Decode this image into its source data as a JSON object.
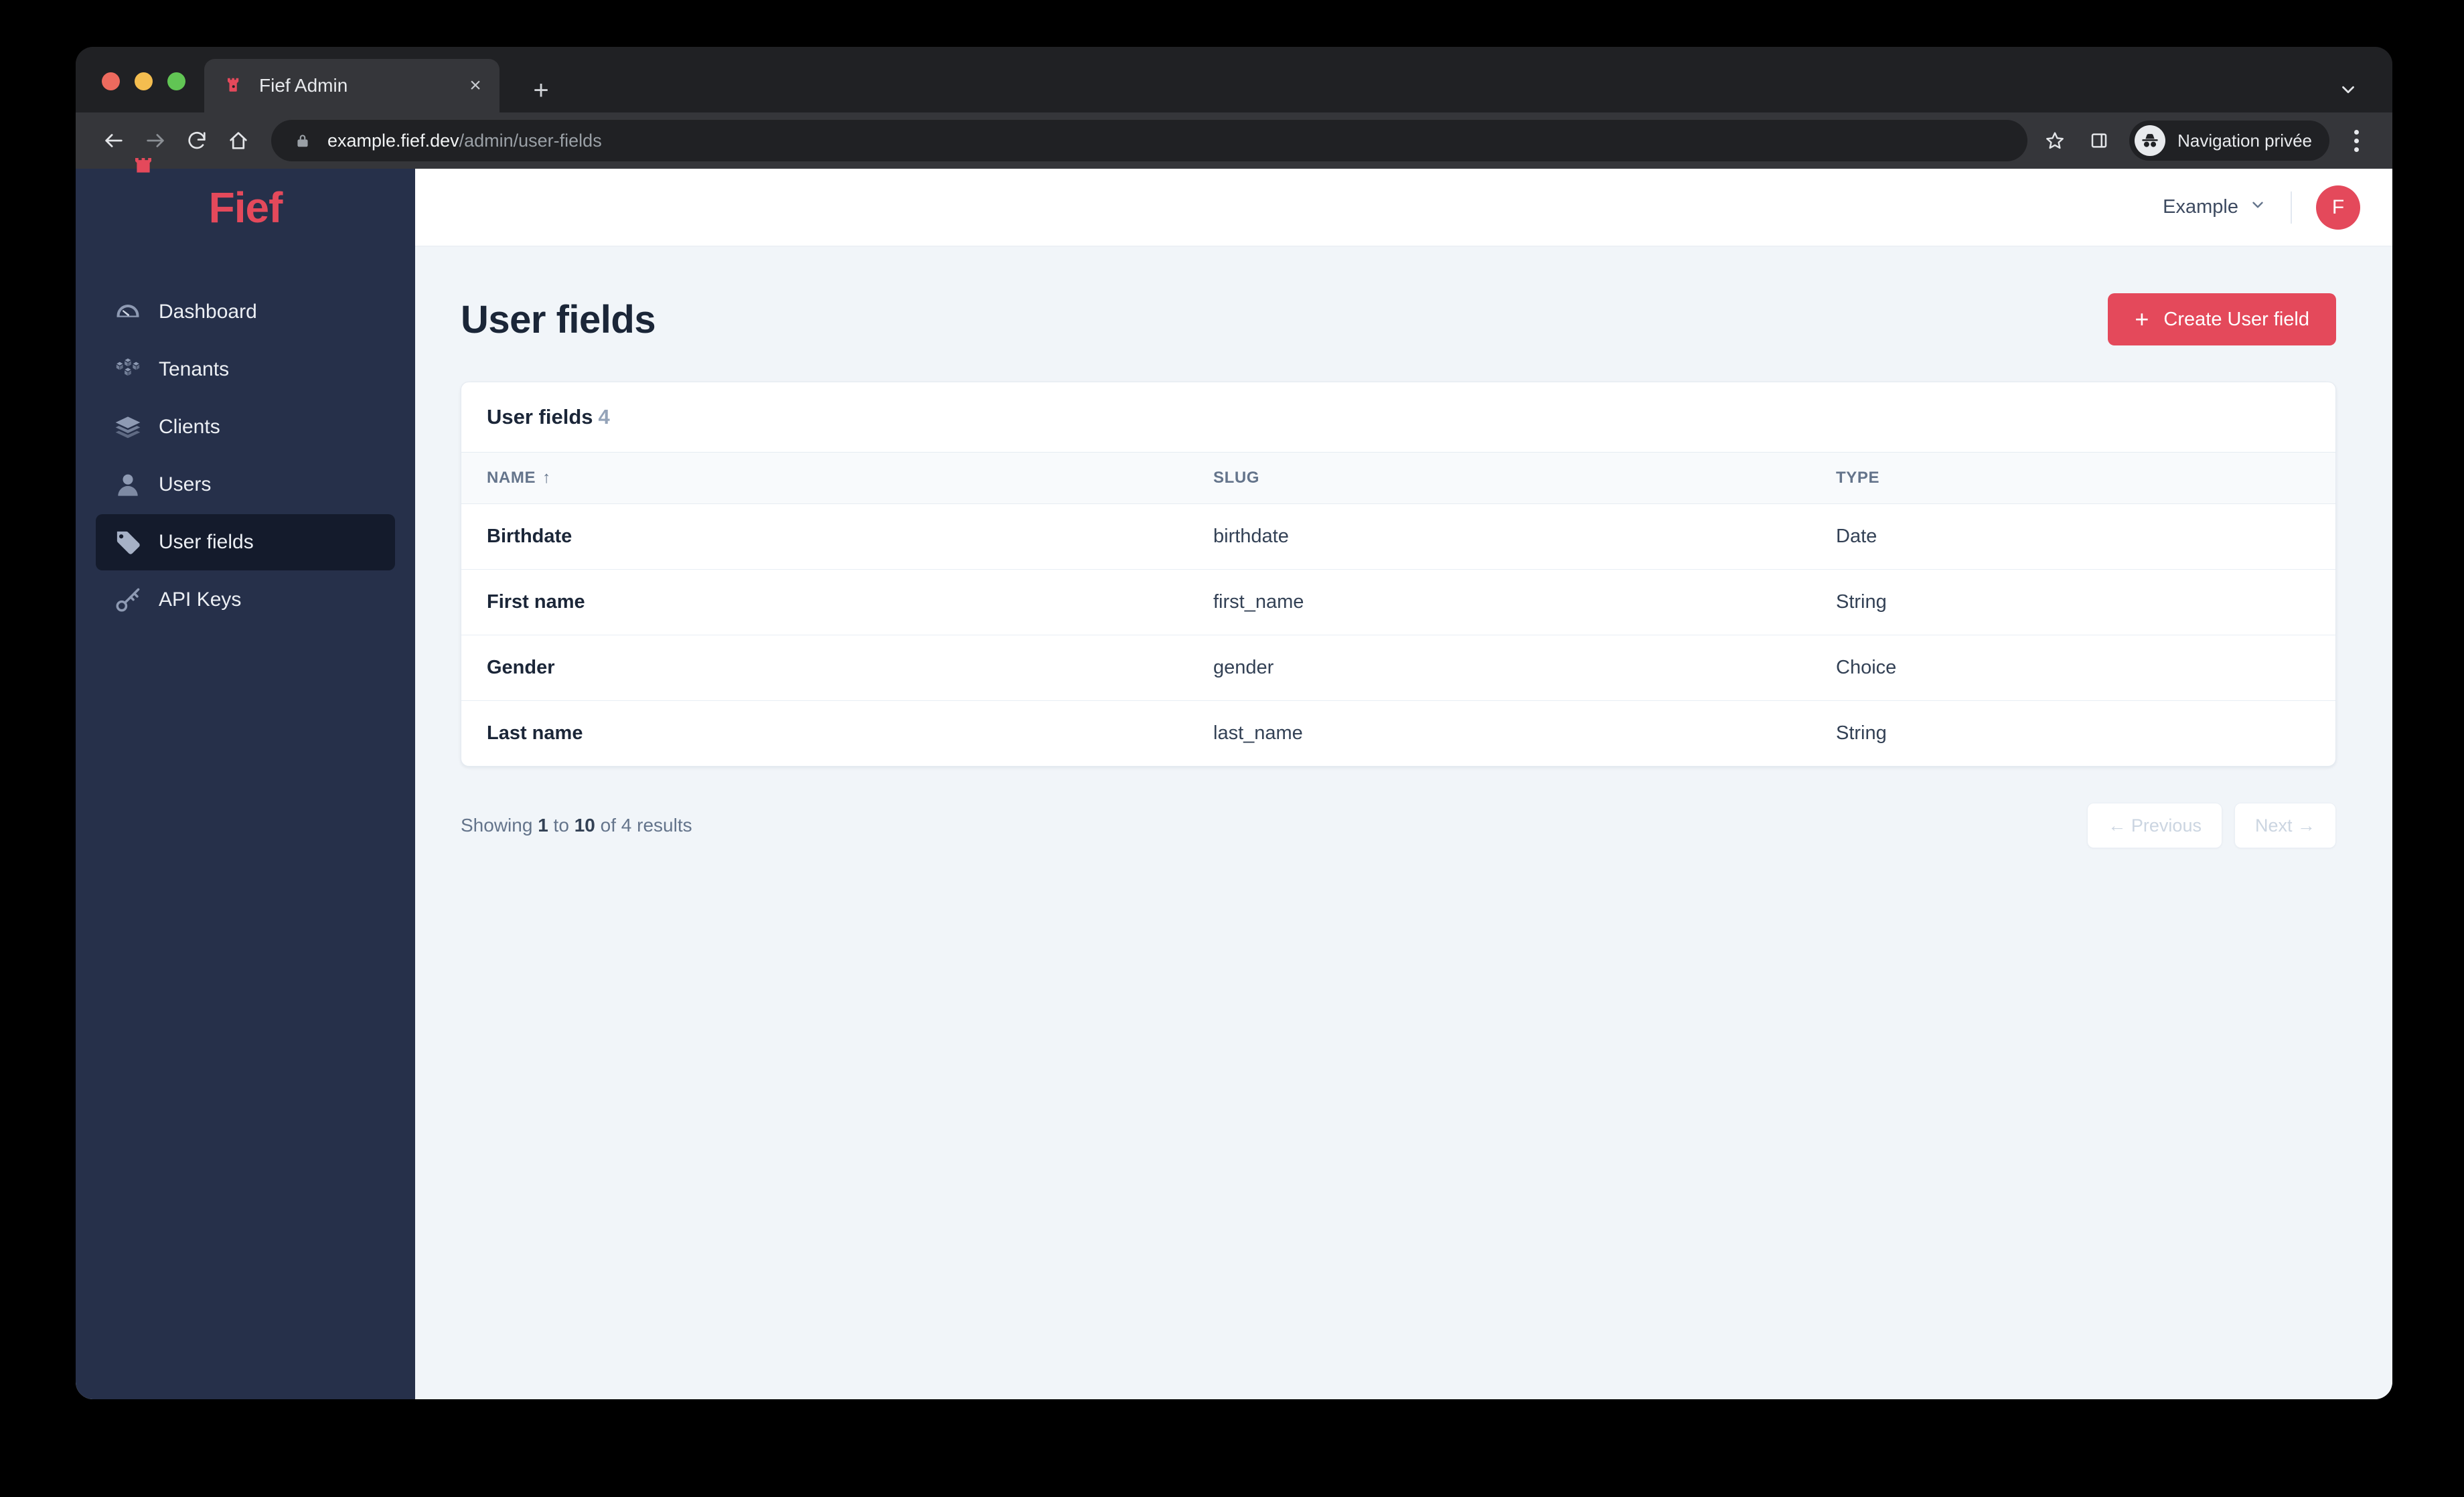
{
  "browser": {
    "tab": {
      "title": "Fief Admin",
      "favicon_icon": "fief-castle-icon",
      "close_icon": "close-icon"
    },
    "new_tab_icon": "plus-icon",
    "tab_list_icon": "chevron-down-icon",
    "nav": {
      "back_icon": "back-arrow-icon",
      "forward_icon": "forward-arrow-icon",
      "reload_icon": "reload-icon",
      "home_icon": "home-icon"
    },
    "omnibox": {
      "lock_icon": "lock-icon",
      "url_host": "example.fief.dev",
      "url_path": "/admin/user-fields"
    },
    "bookmark_icon": "star-icon",
    "side_panel_icon": "side-panel-icon",
    "profile": {
      "label": "Navigation privée",
      "icon": "incognito-icon"
    },
    "menu_icon": "kebab-menu-icon"
  },
  "sidebar": {
    "brand": "Fief",
    "items": [
      {
        "label": "Dashboard",
        "icon": "gauge-icon",
        "active": false
      },
      {
        "label": "Tenants",
        "icon": "cubes-icon",
        "active": false
      },
      {
        "label": "Clients",
        "icon": "layers-icon",
        "active": false
      },
      {
        "label": "Users",
        "icon": "user-icon",
        "active": false
      },
      {
        "label": "User fields",
        "icon": "tag-icon",
        "active": true
      },
      {
        "label": "API Keys",
        "icon": "key-icon",
        "active": false
      }
    ]
  },
  "header": {
    "tenant": "Example",
    "tenant_chevron_icon": "chevron-down-icon",
    "avatar_initial": "F"
  },
  "page": {
    "title": "User fields",
    "create_button": {
      "label": "Create User field",
      "icon": "plus-icon"
    }
  },
  "card": {
    "title": "User fields",
    "count": "4"
  },
  "table": {
    "columns": [
      {
        "label": "NAME",
        "sorted": true,
        "sort_icon": "↑"
      },
      {
        "label": "SLUG",
        "sorted": false,
        "sort_icon": ""
      },
      {
        "label": "TYPE",
        "sorted": false,
        "sort_icon": ""
      }
    ],
    "rows": [
      {
        "name": "Birthdate",
        "slug": "birthdate",
        "type": "Date"
      },
      {
        "name": "First name",
        "slug": "first_name",
        "type": "String"
      },
      {
        "name": "Gender",
        "slug": "gender",
        "type": "Choice"
      },
      {
        "name": "Last name",
        "slug": "last_name",
        "type": "String"
      }
    ]
  },
  "pagination": {
    "showing_prefix": "Showing",
    "from": "1",
    "to_word": "to",
    "to": "10",
    "of_word": "of",
    "total": "4",
    "results_word": "results",
    "previous_label": "← Previous",
    "next_label": "Next →"
  },
  "colors": {
    "brand": "#e4495b",
    "sidebar_bg": "#26304a",
    "sidebar_active_bg": "#141b2c",
    "content_bg": "#f1f5f9",
    "text_dark": "#1b2638"
  }
}
